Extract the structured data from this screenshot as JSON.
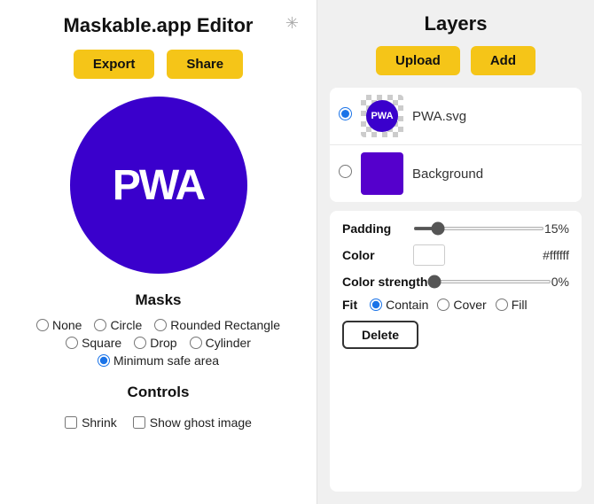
{
  "app": {
    "title": "Maskable.app Editor"
  },
  "toolbar": {
    "export_label": "Export",
    "share_label": "Share"
  },
  "preview": {
    "text": "PWA"
  },
  "masks": {
    "section_title": "Masks",
    "options": [
      {
        "id": "none",
        "label": "None",
        "checked": false
      },
      {
        "id": "circle",
        "label": "Circle",
        "checked": false
      },
      {
        "id": "rounded-rectangle",
        "label": "Rounded Rectangle",
        "checked": false
      },
      {
        "id": "square",
        "label": "Square",
        "checked": false
      },
      {
        "id": "drop",
        "label": "Drop",
        "checked": false
      },
      {
        "id": "cylinder",
        "label": "Cylinder",
        "checked": false
      },
      {
        "id": "minimum-safe-area",
        "label": "Minimum safe area",
        "checked": true
      }
    ]
  },
  "controls": {
    "section_title": "Controls",
    "shrink_label": "Shrink",
    "ghost_image_label": "Show ghost image"
  },
  "layers": {
    "title": "Layers",
    "upload_label": "Upload",
    "add_label": "Add",
    "items": [
      {
        "name": "PWA.svg",
        "type": "svg",
        "selected": true
      },
      {
        "name": "Background",
        "type": "bg",
        "selected": false
      }
    ]
  },
  "properties": {
    "padding_label": "Padding",
    "padding_value": "15%",
    "padding_percent": 15,
    "color_label": "Color",
    "color_hex": "#ffffff",
    "color_strength_label": "Color strength",
    "color_strength_value": "0%",
    "color_strength_percent": 0,
    "fit_label": "Fit",
    "fit_options": [
      {
        "id": "contain",
        "label": "Contain",
        "checked": true
      },
      {
        "id": "cover",
        "label": "Cover",
        "checked": false
      },
      {
        "id": "fill",
        "label": "Fill",
        "checked": false
      }
    ],
    "delete_label": "Delete"
  }
}
